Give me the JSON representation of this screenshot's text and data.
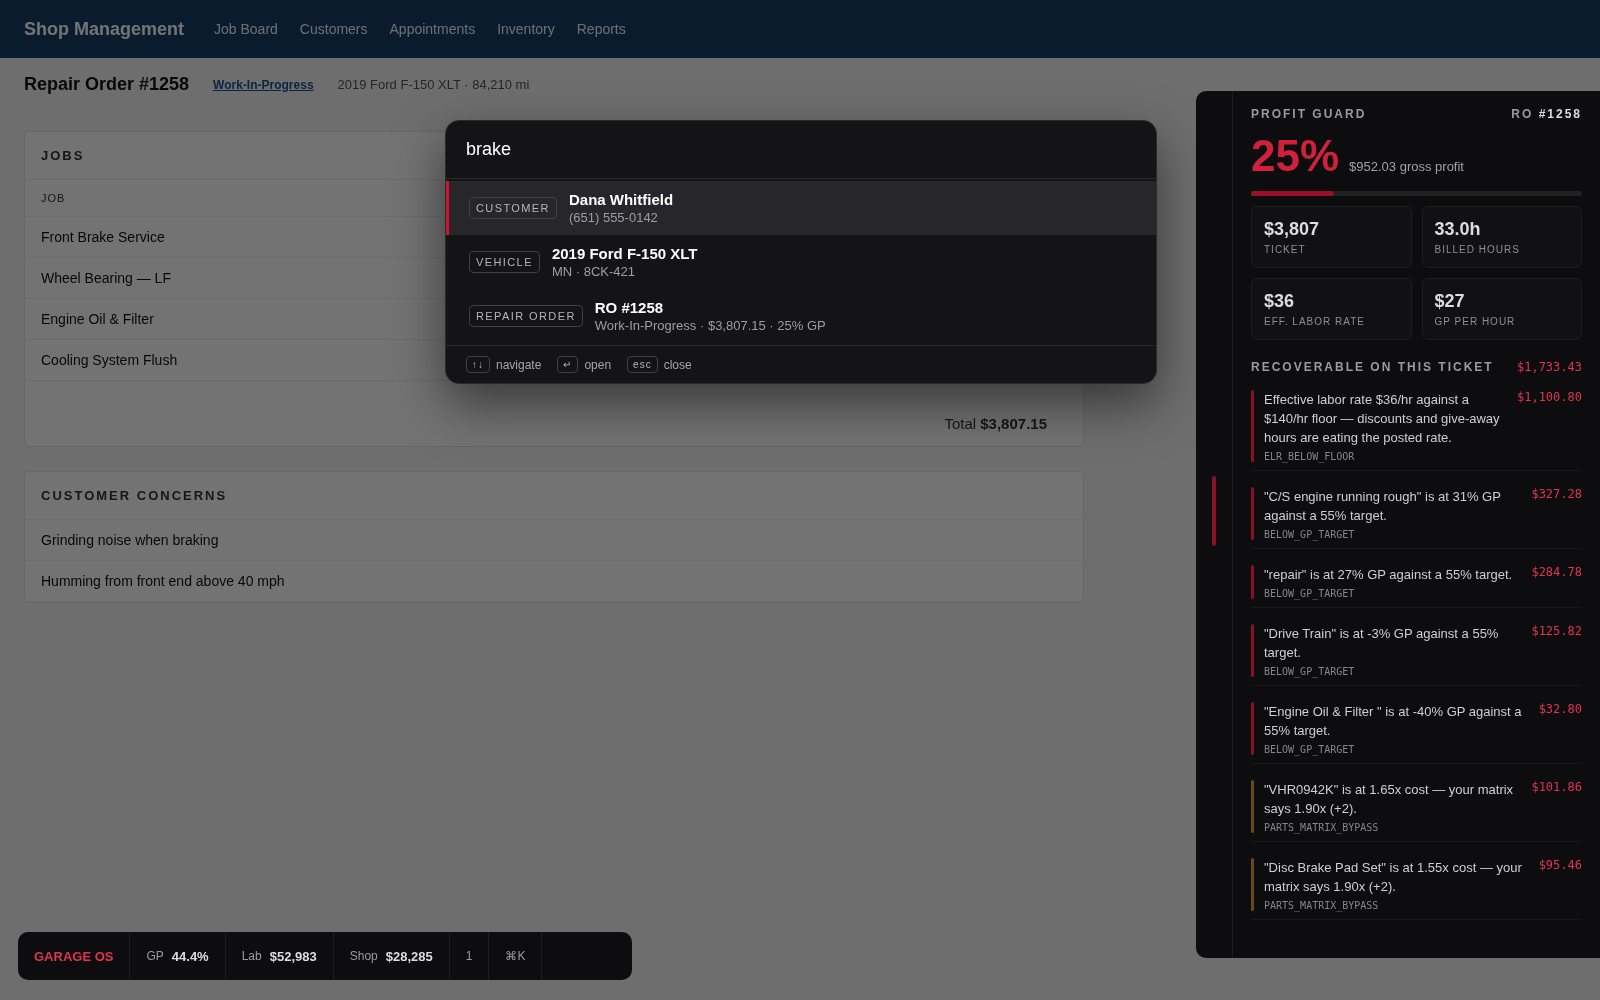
{
  "nav": {
    "brand": "Shop Management",
    "links": [
      "Job Board",
      "Customers",
      "Appointments",
      "Inventory",
      "Reports"
    ]
  },
  "order": {
    "title": "Repair Order #1258",
    "status": "Work-In-Progress",
    "vehicle": "2019 Ford F-150 XLT · 84,210 mi"
  },
  "jobs": {
    "title": "JOBS",
    "column": "JOB",
    "rows": [
      "Front Brake Service",
      "Wheel Bearing — LF",
      "Engine Oil & Filter",
      "Cooling System Flush"
    ],
    "total_label": "Total",
    "total": "$3,807.15"
  },
  "concerns": {
    "title": "CUSTOMER CONCERNS",
    "rows": [
      "Grinding noise when braking",
      "Humming from front end above 40 mph"
    ]
  },
  "profit_guard": {
    "title": "PROFIT GUARD",
    "ro_label": "RO",
    "ro": "#1258",
    "percent": "25%",
    "gross": "$952.03 gross profit",
    "level": 0.25,
    "stats": [
      {
        "value": "$3,807",
        "label": "TICKET"
      },
      {
        "value": "33.0h",
        "label": "BILLED HOURS"
      },
      {
        "value": "$36",
        "label": "EFF. LABOR RATE"
      },
      {
        "value": "$27",
        "label": "GP PER HOUR"
      }
    ],
    "recoverable_title": "RECOVERABLE ON THIS TICKET",
    "recoverable_total": "$1,733.43",
    "items": [
      {
        "text": "Effective labor rate $36/hr against a $140/hr floor — discounts and give-away hours are eating the posted rate.",
        "amount": "$1,100.80",
        "code": "ELR_BELOW_FLOOR",
        "color": "#8a1023"
      },
      {
        "text": "\"C/S engine running rough\" is at 31% GP against a 55% target.",
        "amount": "$327.28",
        "code": "BELOW_GP_TARGET",
        "color": "#8a1023"
      },
      {
        "text": "\"repair\" is at 27% GP against a 55% target.",
        "amount": "$284.78",
        "code": "BELOW_GP_TARGET",
        "color": "#8a1023"
      },
      {
        "text": "\"Drive Train\" is at -3% GP against a 55% target.",
        "amount": "$125.82",
        "code": "BELOW_GP_TARGET",
        "color": "#8a1023"
      },
      {
        "text": "\"Engine Oil & Filter \" is at -40% GP against a 55% target.",
        "amount": "$32.80",
        "code": "BELOW_GP_TARGET",
        "color": "#8a1023"
      },
      {
        "text": "\"VHR0942K\" is at 1.65x cost — your matrix says 1.90x (+2).",
        "amount": "$101.86",
        "code": "PARTS_MATRIX_BYPASS",
        "color": "#6b4a12"
      },
      {
        "text": "\"Disc Brake Pad Set\" is at 1.55x cost — your matrix says 1.90x (+2).",
        "amount": "$95.46",
        "code": "PARTS_MATRIX_BYPASS",
        "color": "#6b4a12"
      }
    ]
  },
  "status_bar": {
    "brand": "GARAGE OS",
    "items": [
      {
        "label": "GP",
        "value": "44.4%"
      },
      {
        "label": "Lab",
        "value": "$52,983"
      },
      {
        "label": "Shop",
        "value": "$28,285"
      }
    ],
    "alerts": "1",
    "shortcut": "⌘K"
  },
  "palette": {
    "query": "brake",
    "results": [
      {
        "kind": "CUSTOMER",
        "title": "Dana Whitfield",
        "subtitle": "(651) 555-0142",
        "selected": true
      },
      {
        "kind": "VEHICLE",
        "title": "2019 Ford F-150 XLT",
        "subtitle": "MN · 8CK-421",
        "selected": false
      },
      {
        "kind": "REPAIR ORDER",
        "title": "RO #1258",
        "subtitle": "Work-In-Progress · $3,807.15 · 25% GP",
        "selected": false
      }
    ],
    "hints": [
      {
        "key": "↑↓",
        "label": "navigate"
      },
      {
        "key": "↵",
        "label": "open"
      },
      {
        "key": "esc",
        "label": "close"
      }
    ]
  }
}
